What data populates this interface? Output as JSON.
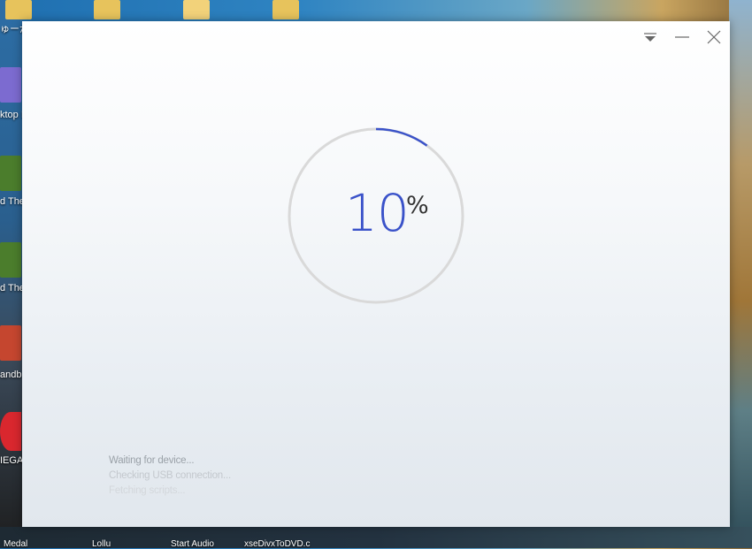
{
  "desktop": {
    "icons": [
      {
        "name": "folder-icon",
        "label": ""
      },
      {
        "name": "candle-icon",
        "label": "ktop I"
      },
      {
        "name": "game-icon",
        "label": "d The"
      },
      {
        "name": "game-icon",
        "label": "d The"
      },
      {
        "name": "sandbox-icon",
        "label": "andb"
      },
      {
        "name": "mega-icon",
        "label": "IEGA"
      }
    ],
    "bottom_labels": [
      "Medal",
      "Lollu",
      "Start Audio",
      "xseDivxToDVD.c"
    ],
    "top_label": "ゅーが"
  },
  "window": {
    "controls": {
      "menu_icon": "dropdown-triangle-icon",
      "minimize_icon": "minimize-icon",
      "close_icon": "close-icon"
    },
    "progress": {
      "value": "10",
      "unit": "%",
      "fraction": 0.1,
      "ring_color": "#d9d9d9",
      "arc_color": "#3a52c9"
    },
    "status_lines": [
      {
        "text": "Waiting for device...",
        "color": "#9aa1a8"
      },
      {
        "text": "Checking USB connection...",
        "color": "#c3c8cd"
      },
      {
        "text": "Fetching scripts...",
        "color": "#d3d7db"
      }
    ]
  }
}
